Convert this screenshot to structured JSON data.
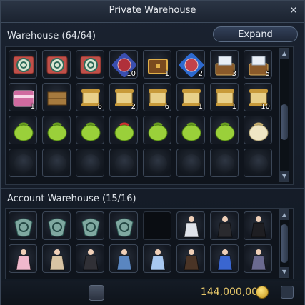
{
  "window": {
    "title": "Private Warehouse",
    "close_glyph": "✕"
  },
  "warehouse": {
    "label": "Warehouse (64/64)",
    "expand_label": "Expand",
    "slots": [
      {
        "icon": "rune-scroll-icon",
        "qty": ""
      },
      {
        "icon": "rune-scroll-icon",
        "qty": ""
      },
      {
        "icon": "rune-scroll-icon",
        "qty": ""
      },
      {
        "icon": "purple-rune-icon",
        "qty": "10"
      },
      {
        "icon": "treasure-chest-icon",
        "qty": "1"
      },
      {
        "icon": "blue-rune-icon",
        "qty": "2"
      },
      {
        "icon": "open-chest-icon",
        "qty": "3"
      },
      {
        "icon": "open-chest-icon",
        "qty": "5"
      },
      {
        "icon": "pink-chest-icon",
        "qty": "1"
      },
      {
        "icon": "wooden-box-icon",
        "qty": ""
      },
      {
        "icon": "scroll-icon",
        "qty": "8"
      },
      {
        "icon": "scroll-icon",
        "qty": "2"
      },
      {
        "icon": "scroll-icon",
        "qty": "6"
      },
      {
        "icon": "scroll-icon",
        "qty": "1"
      },
      {
        "icon": "scroll-icon",
        "qty": "1"
      },
      {
        "icon": "scroll-icon",
        "qty": "10"
      },
      {
        "icon": "green-pouch-icon",
        "qty": ""
      },
      {
        "icon": "green-pouch-icon",
        "qty": ""
      },
      {
        "icon": "green-pouch-icon",
        "qty": ""
      },
      {
        "icon": "green-pouch-red-bow-icon",
        "qty": ""
      },
      {
        "icon": "green-pouch-icon",
        "qty": ""
      },
      {
        "icon": "green-pouch-icon",
        "qty": ""
      },
      {
        "icon": "green-pouch-icon",
        "qty": ""
      },
      {
        "icon": "cream-pouch-icon",
        "qty": ""
      },
      {
        "icon": "empty",
        "qty": ""
      },
      {
        "icon": "empty",
        "qty": ""
      },
      {
        "icon": "empty",
        "qty": ""
      },
      {
        "icon": "empty",
        "qty": ""
      },
      {
        "icon": "empty",
        "qty": ""
      },
      {
        "icon": "empty",
        "qty": ""
      },
      {
        "icon": "empty",
        "qty": ""
      },
      {
        "icon": "empty",
        "qty": ""
      }
    ]
  },
  "account_warehouse": {
    "label": "Account Warehouse (15/16)",
    "slots": [
      {
        "icon": "teal-badge-icon",
        "qty": ""
      },
      {
        "icon": "teal-badge-icon",
        "qty": ""
      },
      {
        "icon": "teal-badge-icon",
        "qty": ""
      },
      {
        "icon": "teal-badge-icon",
        "qty": ""
      },
      {
        "icon": "dark",
        "qty": ""
      },
      {
        "icon": "white-dress-icon",
        "qty": ""
      },
      {
        "icon": "black-outfit-icon",
        "qty": ""
      },
      {
        "icon": "black-swimsuit-icon",
        "qty": ""
      },
      {
        "icon": "pink-dress-icon",
        "qty": ""
      },
      {
        "icon": "beige-coat-icon",
        "qty": ""
      },
      {
        "icon": "black-dress-icon",
        "qty": ""
      },
      {
        "icon": "denim-outfit-icon",
        "qty": ""
      },
      {
        "icon": "blue-white-dress-icon",
        "qty": ""
      },
      {
        "icon": "leather-outfit-icon",
        "qty": ""
      },
      {
        "icon": "blue-sailor-icon",
        "qty": ""
      },
      {
        "icon": "gothic-outfit-icon",
        "qty": ""
      }
    ]
  },
  "footer": {
    "gold_amount": "144,000,000"
  },
  "colors": {
    "accent_gold": "#e8c86a",
    "panel": "#0f141c"
  }
}
